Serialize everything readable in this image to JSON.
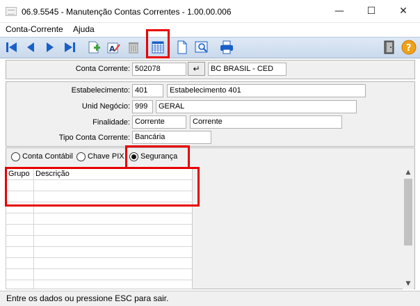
{
  "window": {
    "title": "06.9.5545 - Manutenção Contas Correntes - 1.00.00.006",
    "minimize": "—",
    "maximize": "☐",
    "close": "✕"
  },
  "menu": {
    "items": [
      "Conta-Corrente",
      "Ajuda"
    ]
  },
  "toolbar": {
    "icons": [
      "first-record-icon",
      "previous-record-icon",
      "next-record-icon",
      "last-record-icon",
      "add-record-icon",
      "edit-record-icon",
      "delete-record-icon",
      "calendar-grid-icon",
      "blank-document-icon",
      "preview-icon",
      "print-icon",
      "exit-door-icon",
      "help-icon"
    ],
    "highlight_color": "#e60000"
  },
  "conta": {
    "label": "Conta Corrente:",
    "value": "502078",
    "enter_symbol": "↵",
    "name": "BC BRASIL - CED"
  },
  "details": {
    "estabelecimento_label": "Estabelecimento:",
    "estabelecimento_code": "401",
    "estabelecimento_name": "Estabelecimento 401",
    "unid_label": "Unid Negócio:",
    "unid_code": "999",
    "unid_name": "GERAL",
    "finalidade_label": "Finalidade:",
    "finalidade_value": "Corrente",
    "finalidade_desc": "Corrente",
    "tipo_label": "Tipo Conta Corrente:",
    "tipo_value": "Bancária"
  },
  "radios": [
    {
      "label": "Conta Contábil",
      "selected": false
    },
    {
      "label": "Chave PIX",
      "selected": false
    },
    {
      "label": "Segurança",
      "selected": true
    }
  ],
  "grid": {
    "columns": [
      "Grupo",
      "Descrição"
    ],
    "rows": []
  },
  "scrollbar": {
    "up": "▲",
    "down": "▼"
  },
  "status": {
    "text": "Entre os dados ou pressione ESC para sair."
  }
}
